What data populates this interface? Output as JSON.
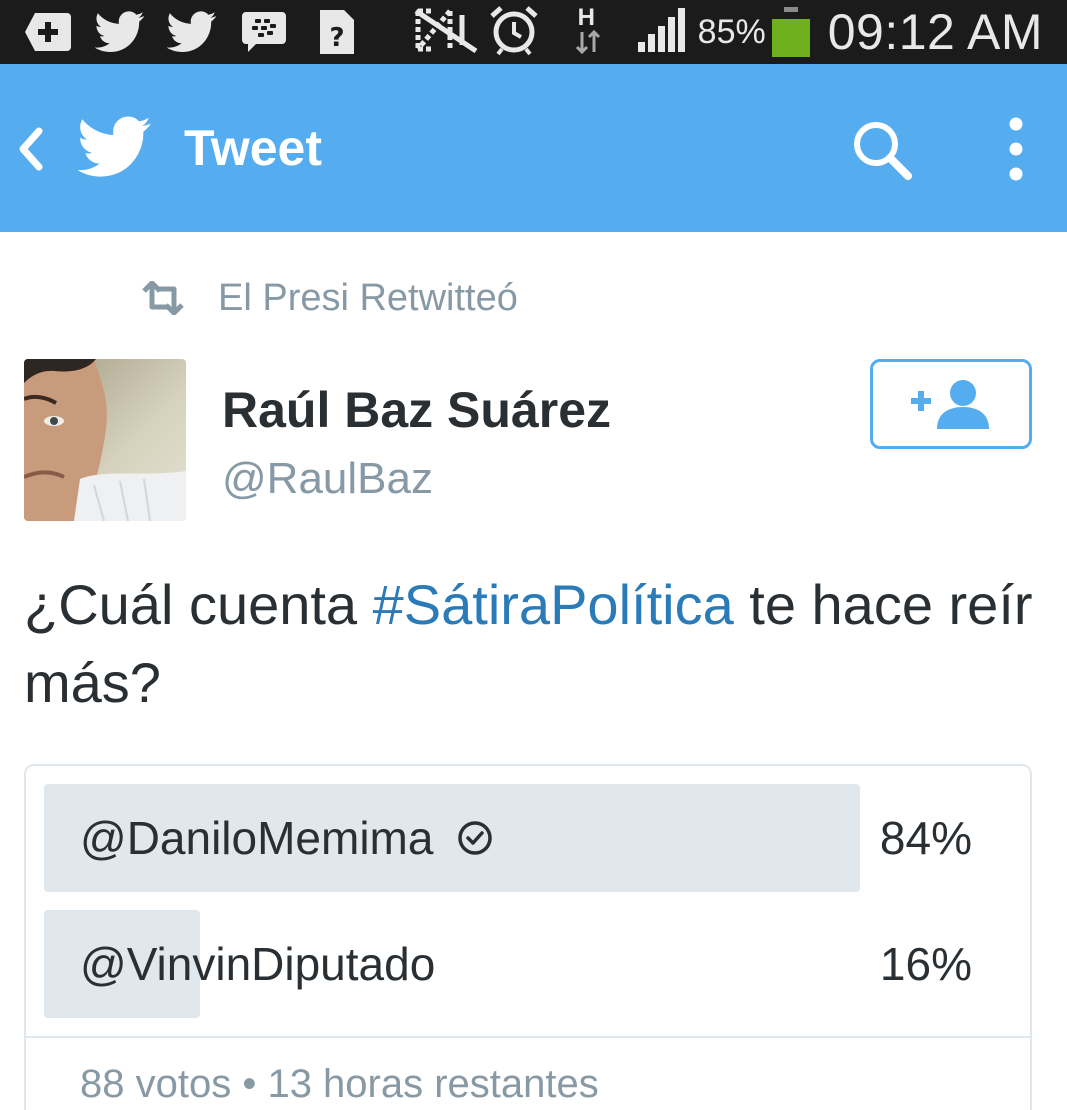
{
  "status_bar": {
    "left_icons": [
      "add-box-icon",
      "twitter-bird-icon",
      "twitter-bird-icon",
      "bbm-chat-icon",
      "unknown-sim-icon"
    ],
    "right_icons": [
      "nfc-off-icon",
      "alarm-icon",
      "hspa-data-icon",
      "signal-bars-icon"
    ],
    "data_indicator": "H",
    "battery_percent": "85%",
    "battery_level": 0.85,
    "time": "09:12 AM"
  },
  "app_bar": {
    "title": "Tweet",
    "color": "#55acee"
  },
  "retweet": {
    "text": "El Presi Retwitteó"
  },
  "author": {
    "name": "Raúl Baz Suárez",
    "handle": "@RaulBaz"
  },
  "tweet": {
    "text_before": "¿Cuál cuenta ",
    "hashtag": "#SátiraPolítica",
    "text_after": " te hace reír más?",
    "hashtag_color": "#2b7bb9"
  },
  "poll": {
    "options": [
      {
        "label": "@DaniloMemima",
        "percent_label": "84%",
        "percent": 84,
        "selected": true
      },
      {
        "label": "@VinvinDiputado",
        "percent_label": "16%",
        "percent": 16,
        "selected": false
      }
    ],
    "footer": "88 votos • 13 horas restantes"
  }
}
